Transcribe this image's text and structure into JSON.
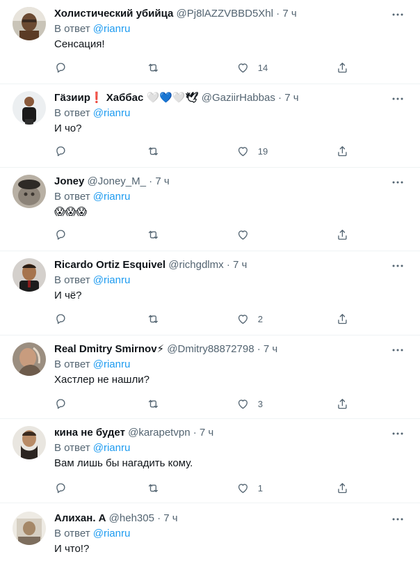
{
  "tweets": [
    {
      "name": "Холистический убийца",
      "handle": "@Pj8lAZZVBBD5Xhl",
      "time": "7 ч",
      "reply_prefix": "В ответ",
      "reply_to": "@rianru",
      "text": "Сенсация!",
      "likes": "14"
    },
    {
      "name": "Гäзиир❗ Хаббас 🤍💙🤍🕊",
      "handle": "@GaziirHabbas",
      "time": "7 ч",
      "reply_prefix": "В ответ",
      "reply_to": "@rianru",
      "text": "И чо?",
      "likes": "19"
    },
    {
      "name": "Joney",
      "handle": "@Joney_M_",
      "time": "7 ч",
      "reply_prefix": "В ответ",
      "reply_to": "@rianru",
      "text": "😱😱😱",
      "likes": ""
    },
    {
      "name": "Ricardo Ortiz Esquivel",
      "handle": "@richgdlmx",
      "time": "7 ч",
      "reply_prefix": "В ответ",
      "reply_to": "@rianru",
      "text": "И чё?",
      "likes": "2"
    },
    {
      "name": "Real Dmitry Smirnov⚡",
      "handle": "@Dmitry88872798",
      "time": "7 ч",
      "reply_prefix": "В ответ",
      "reply_to": "@rianru",
      "text": "Хастлер не нашли?",
      "likes": "3"
    },
    {
      "name": "кина не будет",
      "handle": "@karapetvpn",
      "time": "7 ч",
      "reply_prefix": "В ответ",
      "reply_to": "@rianru",
      "text": "Вам лишь бы нагадить кому.",
      "likes": "1"
    },
    {
      "name": "Алихан. А",
      "handle": "@heh305",
      "time": "7 ч",
      "reply_prefix": "В ответ",
      "reply_to": "@rianru",
      "text": "И что!?",
      "likes": ""
    }
  ],
  "dot": "·",
  "colors": {
    "accent": "#1d9bf0",
    "secondary_text": "#536471",
    "primary_text": "#0f1419",
    "divider": "#eff3f4"
  },
  "icons": [
    "reply-icon",
    "retweet-icon",
    "like-icon",
    "share-icon",
    "more-icon"
  ]
}
